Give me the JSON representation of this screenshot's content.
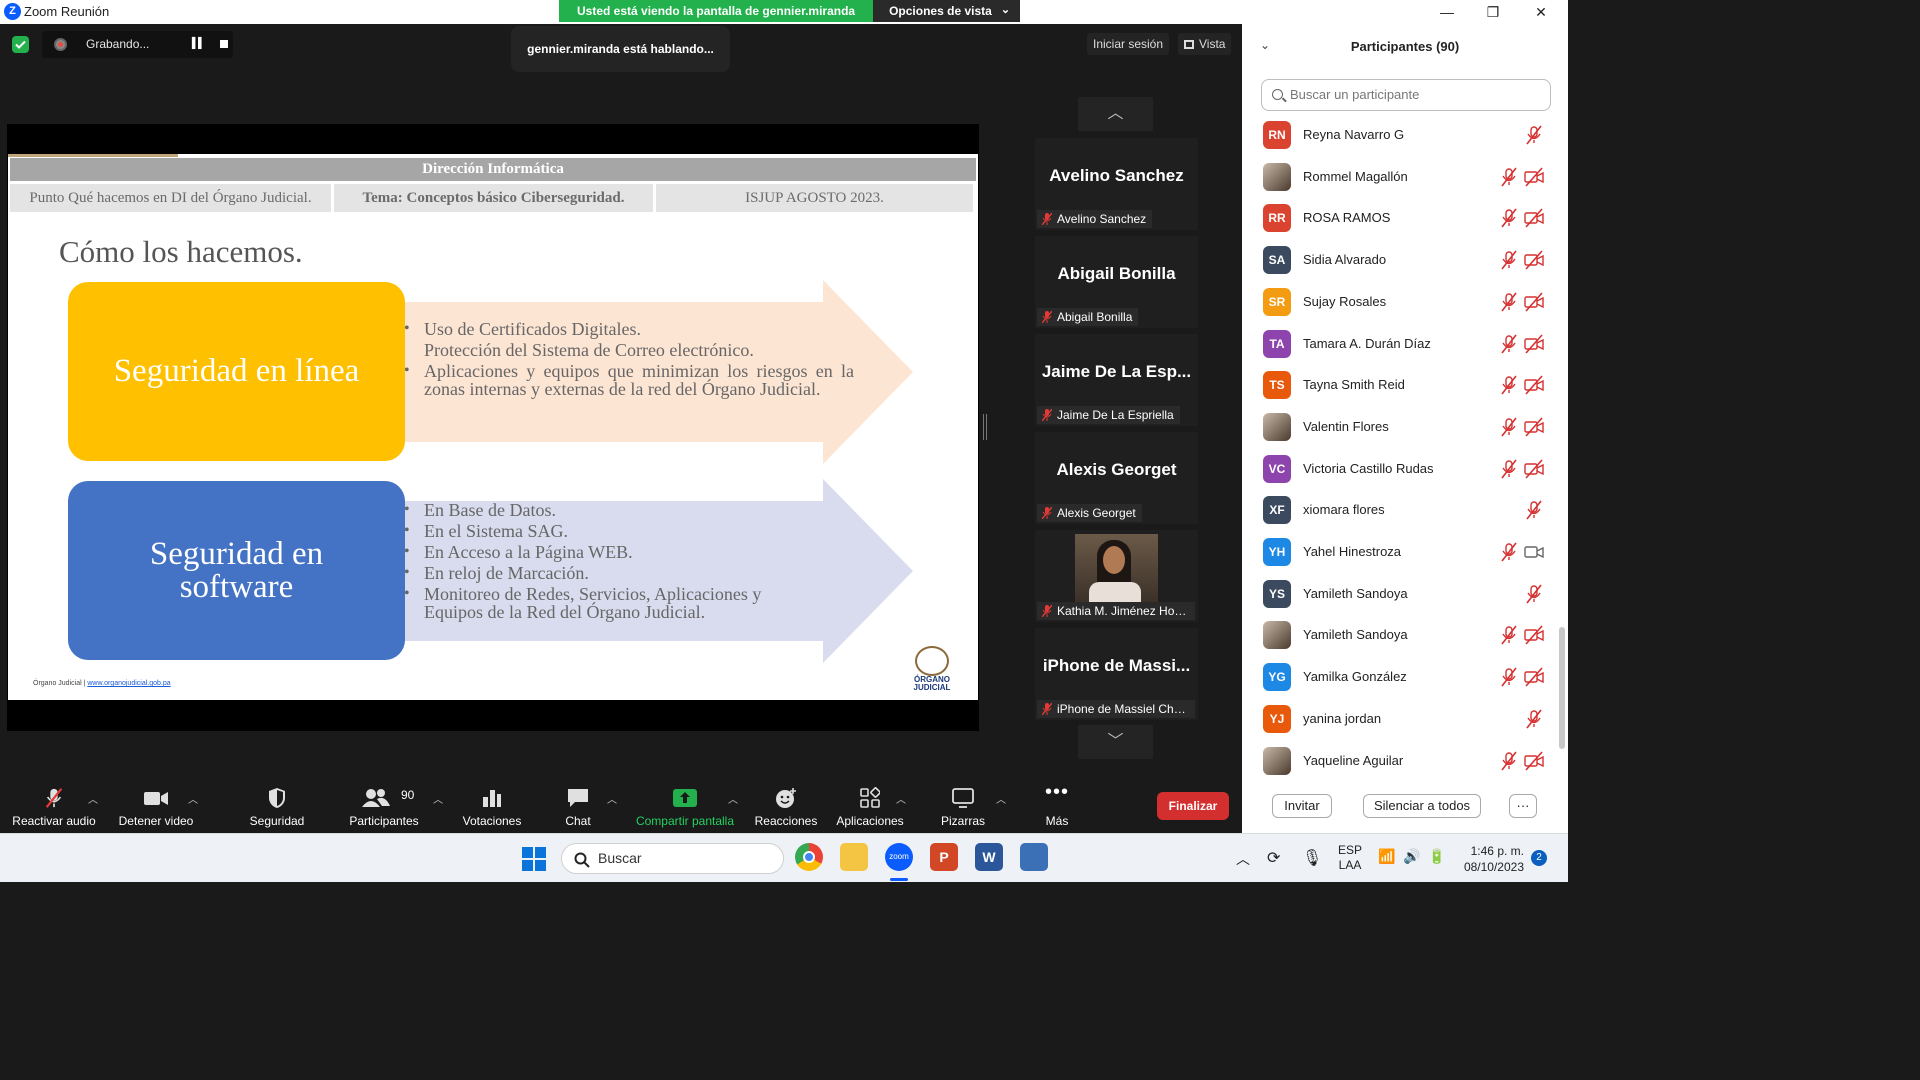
{
  "titlebar": {
    "app_title": "Zoom Reunión",
    "banner_text": "Usted está viendo la pantalla de gennier.miranda",
    "view_options": "Opciones de vista"
  },
  "recording": {
    "label": "Grabando..."
  },
  "speaking": "gennier.miranda está hablando...",
  "top_right": {
    "signin": "Iniciar sesión",
    "view": "Vista"
  },
  "slide": {
    "header": "Dirección Informática",
    "subheaders": [
      "Punto Qué hacemos en DI del Órgano Judicial.",
      "Tema: Conceptos básico Ciberseguridad.",
      "ISJUP AGOSTO 2023."
    ],
    "heading": "Cómo los hacemos.",
    "box1": "Seguridad en línea",
    "box1_bullets": [
      "Uso de Certificados Digitales.",
      "Protección del Sistema de Correo electrónico.",
      "Aplicaciones y equipos que minimizan los riesgos en la zonas internas y externas de la red del Órgano Judicial."
    ],
    "box2": "Seguridad en software",
    "box2_bullets": [
      "En Base de Datos.",
      "En el Sistema SAG.",
      "En Acceso a la Página WEB.",
      "En reloj de Marcación.",
      "Monitoreo de Redes, Servicios, Aplicaciones y Equipos de la Red del Órgano Judicial."
    ],
    "footer_org": "Órgano Judicial |",
    "footer_link": "www.organojudicial.gob.pa",
    "logo_text": "ÓRGANO JUDICIAL",
    "colors": {
      "box1": "#ffc000",
      "box2": "#4472c4"
    }
  },
  "thumbnails": [
    {
      "name": "Avelino Sanchez",
      "tag": "Avelino Sanchez"
    },
    {
      "name": "Abigail Bonilla",
      "tag": "Abigail Bonilla"
    },
    {
      "name": "Jaime De La Esp...",
      "tag": "Jaime De La Espriella"
    },
    {
      "name": "Alexis Georget",
      "tag": "Alexis Georget"
    },
    {
      "name": "",
      "tag": "Kathia M. Jiménez Hos..."
    },
    {
      "name": "iPhone de Massi...",
      "tag": "iPhone de Massiel Chá..."
    }
  ],
  "toolbar": {
    "mute": "Reactivar audio",
    "video": "Detener video",
    "security": "Seguridad",
    "participants": "Participantes",
    "participants_count": "90",
    "polls": "Votaciones",
    "chat": "Chat",
    "share": "Compartir pantalla",
    "reactions": "Reacciones",
    "apps": "Aplicaciones",
    "whiteboards": "Pizarras",
    "more": "Más",
    "end": "Finalizar"
  },
  "panel": {
    "title": "Participantes (90)",
    "search_placeholder": "Buscar un participante",
    "participants": [
      {
        "initials": "RN",
        "name": "Reyna Navarro G",
        "color": "#d9432f",
        "cam": false
      },
      {
        "initials": "",
        "name": "Rommel Magallón",
        "color": "",
        "cam": true,
        "photo": true
      },
      {
        "initials": "RR",
        "name": "ROSA RAMOS",
        "color": "#d9432f",
        "cam": true
      },
      {
        "initials": "SA",
        "name": "Sidia Alvarado",
        "color": "#3b4a5e",
        "cam": true
      },
      {
        "initials": "SR",
        "name": "Sujay Rosales",
        "color": "#f39c12",
        "cam": true
      },
      {
        "initials": "TA",
        "name": "Tamara A. Durán Díaz",
        "color": "#8e44ad",
        "cam": true
      },
      {
        "initials": "TS",
        "name": "Tayna Smith Reid",
        "color": "#e8590c",
        "cam": true
      },
      {
        "initials": "",
        "name": "Valentin Flores",
        "color": "",
        "cam": true,
        "photo": true
      },
      {
        "initials": "VC",
        "name": "Victoria Castillo Rudas",
        "color": "#8e44ad",
        "cam": true
      },
      {
        "initials": "XF",
        "name": "xiomara flores",
        "color": "#3b4a5e",
        "cam": false
      },
      {
        "initials": "YH",
        "name": "Yahel Hinestroza",
        "color": "#1e88e5",
        "cam": true,
        "cam_on": true
      },
      {
        "initials": "YS",
        "name": "Yamileth Sandoya",
        "color": "#3b4a5e",
        "cam": false
      },
      {
        "initials": "",
        "name": "Yamileth Sandoya",
        "color": "",
        "cam": true,
        "photo": true
      },
      {
        "initials": "YG",
        "name": "Yamilka González",
        "color": "#1e88e5",
        "cam": true
      },
      {
        "initials": "YJ",
        "name": "yanina jordan",
        "color": "#e8590c",
        "cam": false
      },
      {
        "initials": "",
        "name": "Yaqueline Aguilar",
        "color": "",
        "cam": true,
        "photo": true
      }
    ],
    "invite": "Invitar",
    "mute_all": "Silenciar a todos",
    "more": "···"
  },
  "taskbar": {
    "search": "Buscar",
    "lang1": "ESP",
    "lang2": "LAA",
    "time": "1:46 p. m.",
    "date": "08/10/2023",
    "badge": "2"
  }
}
